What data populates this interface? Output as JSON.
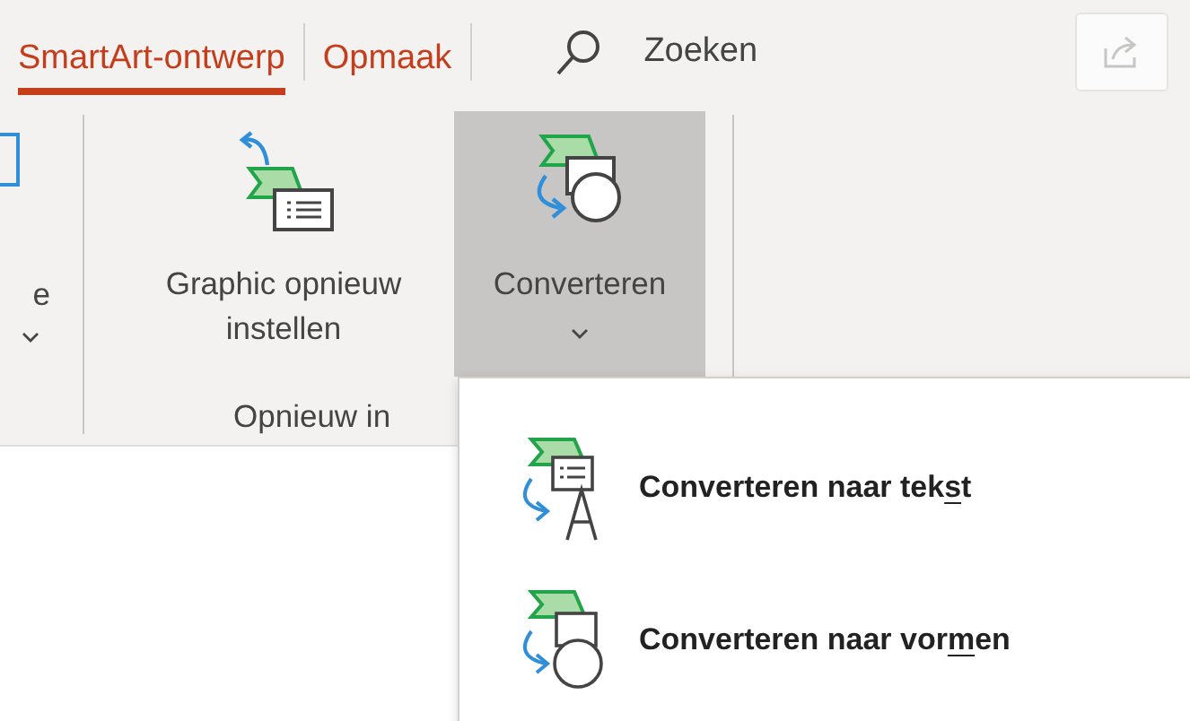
{
  "tabs": [
    {
      "label": "SmartArt-ontwerp",
      "selected": true
    },
    {
      "label": "Opmaak",
      "selected": false
    }
  ],
  "search": {
    "placeholder": "Zoeken"
  },
  "ribbon": {
    "buttons": [
      {
        "kind": "partial",
        "label": "e"
      },
      {
        "kind": "reset",
        "label": "Graphic opnieuw instellen"
      },
      {
        "kind": "convert",
        "label": "Converteren",
        "pressed": true
      }
    ],
    "group_label": "Opnieuw in"
  },
  "menu": {
    "items": [
      {
        "kind": "text",
        "label_before": "Converteren naar tek",
        "access_key": "s",
        "label_after": "t"
      },
      {
        "kind": "shapes",
        "label_before": "Converteren naar vor",
        "access_key": "m",
        "label_after": "en"
      }
    ]
  }
}
